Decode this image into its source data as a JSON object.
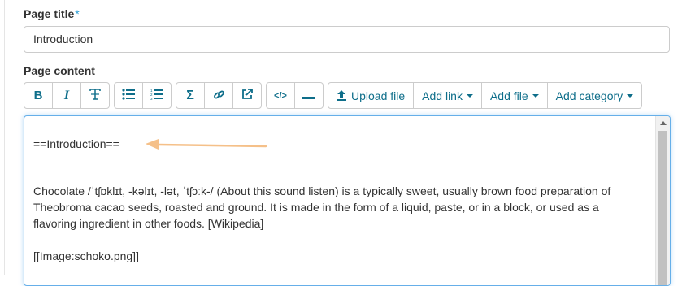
{
  "form": {
    "title_label": "Page title",
    "required_mark": "*",
    "title_value": "Introduction",
    "content_label": "Page content"
  },
  "toolbar": {
    "groups": [
      [
        {
          "icon": "bold-icon",
          "glyph": "B"
        },
        {
          "icon": "italic-icon",
          "glyph": "I"
        },
        {
          "icon": "clear-format-icon",
          "glyph": "T"
        }
      ],
      [
        {
          "icon": "bulleted-list-icon"
        },
        {
          "icon": "numbered-list-icon"
        }
      ],
      [
        {
          "icon": "sigma-icon",
          "glyph": "Σ"
        },
        {
          "icon": "link-icon"
        },
        {
          "icon": "external-link-icon"
        }
      ],
      [
        {
          "icon": "code-icon",
          "glyph": "</>"
        },
        {
          "icon": "horizontal-rule-icon"
        }
      ]
    ],
    "upload_label": "Upload file",
    "add_link_label": "Add link",
    "add_file_label": "Add file",
    "add_category_label": "Add category"
  },
  "editor": {
    "heading": "==Introduction==",
    "paragraph_lines": [
      "Chocolate /ˈtʃɒklɪt, -kəlɪt, -lət, ˈtʃɔːk-/ (About this sound listen) is a typically sweet, usually brown food preparation of",
      "Theobroma cacao seeds, roasted and ground. It is made in the form of a liquid, paste, or in a block, or used as a",
      "flavoring ingredient in other foods. [Wikipedia]"
    ],
    "image_markup": "[[Image:schoko.png]]"
  },
  "colors": {
    "accent": "#0e6e8a",
    "focus_border": "#66afe9",
    "annotation_arrow": "#f5c089",
    "required": "#2a9fd6"
  }
}
